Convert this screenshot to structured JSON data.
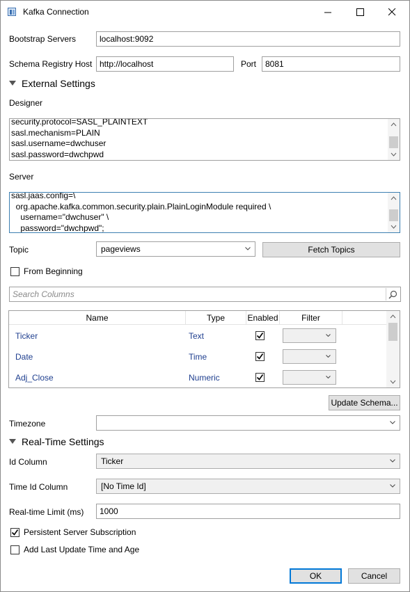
{
  "window": {
    "title": "Kafka Connection"
  },
  "bootstrap": {
    "label": "Bootstrap Servers",
    "value": "localhost:9092"
  },
  "schema_registry": {
    "label": "Schema Registry Host",
    "value": "http://localhost",
    "port_label": "Port",
    "port_value": "8081"
  },
  "external_settings": {
    "header": "External Settings",
    "designer_label": "Designer",
    "designer_lines": [
      "security.protocol=SASL_PLAINTEXT",
      "sasl.mechanism=PLAIN",
      "sasl.username=dwchuser",
      "sasl.password=dwchpwd"
    ],
    "server_label": "Server",
    "server_lines": [
      "sasl.jaas.config=\\",
      "  org.apache.kafka.common.security.plain.PlainLoginModule required \\",
      "    username=\"dwchuser\" \\",
      "    password=\"dwchpwd\";"
    ]
  },
  "topic": {
    "label": "Topic",
    "value": "pageviews",
    "fetch_button": "Fetch Topics"
  },
  "from_beginning": {
    "label": "From Beginning",
    "checked": false
  },
  "search": {
    "placeholder": "Search Columns"
  },
  "columns_grid": {
    "headers": [
      "Name",
      "Type",
      "Enabled",
      "Filter"
    ],
    "rows": [
      {
        "name": "Ticker",
        "type": "Text",
        "enabled": true
      },
      {
        "name": "Date",
        "type": "Time",
        "enabled": true
      },
      {
        "name": "Adj_Close",
        "type": "Numeric",
        "enabled": true
      }
    ]
  },
  "update_schema_button": "Update Schema...",
  "timezone": {
    "label": "Timezone",
    "value": ""
  },
  "realtime_settings": {
    "header": "Real-Time Settings",
    "id_column_label": "Id Column",
    "id_column_value": "Ticker",
    "time_id_label": "Time Id Column",
    "time_id_value": "[No Time Id]",
    "limit_label": "Real-time Limit (ms)",
    "limit_value": "1000"
  },
  "persistent_subscription": {
    "label": "Persistent Server Subscription",
    "checked": true
  },
  "add_last_update": {
    "label": "Add Last Update Time and Age",
    "checked": false
  },
  "footer": {
    "ok": "OK",
    "cancel": "Cancel"
  },
  "colors": {
    "accent": "#0078d7",
    "link_text": "#1f3f8f",
    "border": "#a0a0a0",
    "button_bg": "#e1e1e1"
  }
}
